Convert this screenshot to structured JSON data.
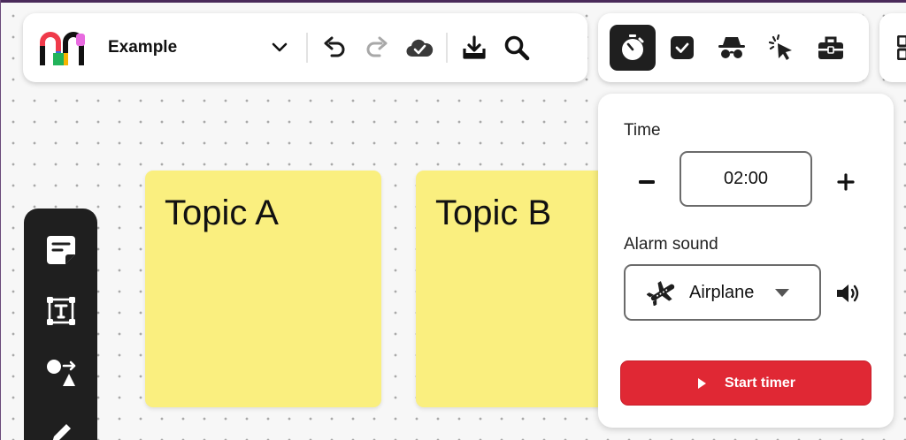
{
  "app": {
    "board_name": "Example"
  },
  "colors": {
    "sticky_note": "#faef7f",
    "start_button": "#e02834",
    "dark_toolbar": "#1f1f1f"
  },
  "toolbar": {
    "items": [
      "logo",
      "board-name-dropdown",
      "undo-icon",
      "redo-icon",
      "cloud-saved-icon",
      "download-icon",
      "search-icon"
    ]
  },
  "tools": {
    "items": [
      "timer-icon",
      "voting-checkbox-icon",
      "private-mode-icon",
      "cursor-icon",
      "toolbox-icon"
    ],
    "active": "timer"
  },
  "sidebar": {
    "items": [
      "sticky-note-icon",
      "text-tool-icon",
      "shapes-icon",
      "pen-icon"
    ]
  },
  "notes": [
    {
      "title": "Topic A"
    },
    {
      "title": "Topic B"
    }
  ],
  "timer": {
    "time_label": "Time",
    "time_value": "02:00",
    "alarm_label": "Alarm sound",
    "alarm_value": "Airplane",
    "start_label": "Start timer"
  }
}
